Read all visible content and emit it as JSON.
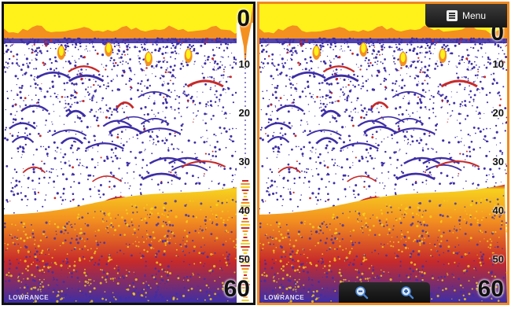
{
  "app": {
    "brand": "LOWRANCE"
  },
  "left_pane": {
    "range_top": "0",
    "range_bottom": "60",
    "ticks": [
      "10",
      "20",
      "30",
      "40",
      "50"
    ]
  },
  "right_pane": {
    "range_top": "0",
    "range_bottom": "60",
    "ticks": [
      "10",
      "20",
      "30",
      "40",
      "50"
    ],
    "menu": {
      "label": "Menu",
      "icon": "menu-icon"
    },
    "zoom": {
      "zoom_out_icon": "zoom-out-icon",
      "zoom_in_icon": "zoom-in-icon"
    }
  },
  "colors": {
    "surface_yellow": "#fff21a",
    "surface_orange": "#f39020",
    "target_red": "#c72a2a",
    "echo_blue": "#3d2ea6",
    "bottom_yellow": "#f6d11e",
    "active_pane_border": "#f0891e",
    "inactive_pane_border": "#111111"
  }
}
